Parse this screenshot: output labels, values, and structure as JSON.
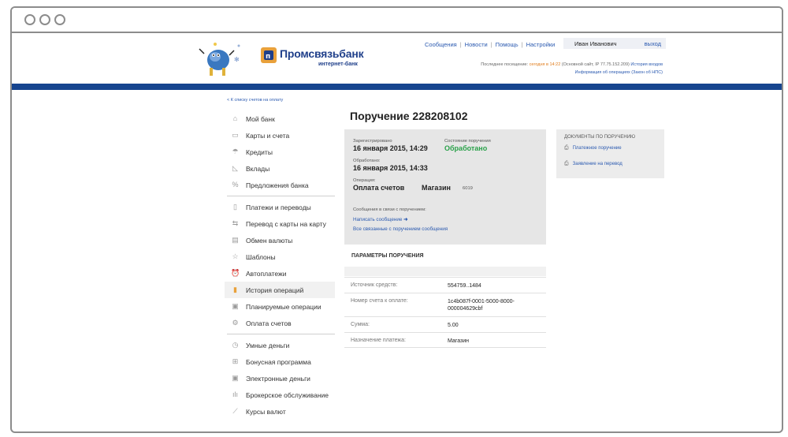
{
  "bank": {
    "name": "Промсвязьбанк",
    "subtitle": "интернет-банк",
    "brand_color": "#1f3f8a",
    "accent_color": "#e9a13b"
  },
  "topnav": {
    "items": [
      "Сообщения",
      "Новости",
      "Помощь",
      "Настройки"
    ],
    "user_name": "Иван Иванович",
    "logout": "выход",
    "last_visit_prefix": "Последнее посещение:",
    "last_visit_today": "сегодня в 14:22",
    "last_visit_site": "(Основной сайт, IP 77.75.152.209)",
    "login_history": "История входов",
    "op_info": "Информация об операциях (Закон об НПС)"
  },
  "back_link": "< К списку счетов на оплату",
  "sidebar": {
    "groups": [
      [
        {
          "label": "Мой банк",
          "icon": "home-icon"
        },
        {
          "label": "Карты и счета",
          "icon": "card-icon"
        },
        {
          "label": "Кредиты",
          "icon": "umbrella-icon"
        },
        {
          "label": "Вклады",
          "icon": "chart-icon"
        },
        {
          "label": "Предложения банка",
          "icon": "percent-icon"
        }
      ],
      [
        {
          "label": "Платежи и переводы",
          "icon": "document-icon"
        },
        {
          "label": "Перевод с карты на карту",
          "icon": "card-transfer-icon"
        },
        {
          "label": "Обмен валюты",
          "icon": "exchange-icon"
        },
        {
          "label": "Шаблоны",
          "icon": "star-icon"
        },
        {
          "label": "Автоплатежи",
          "icon": "alarm-icon"
        },
        {
          "label": "История операций",
          "icon": "history-icon",
          "active": true
        },
        {
          "label": "Планируемые операции",
          "icon": "calendar-icon"
        },
        {
          "label": "Оплата счетов",
          "icon": "bills-icon"
        }
      ],
      [
        {
          "label": "Умные деньги",
          "icon": "clock-icon"
        },
        {
          "label": "Бонусная программа",
          "icon": "gift-icon"
        },
        {
          "label": "Электронные деньги",
          "icon": "wallet-icon"
        },
        {
          "label": "Брокерское обслуживание",
          "icon": "bars-icon"
        },
        {
          "label": "Курсы валют",
          "icon": "trend-icon"
        }
      ]
    ]
  },
  "order": {
    "title": "Поручение 228208102",
    "registered_label": "Зарегистрировано",
    "registered_value": "16 января 2015, 14:29",
    "status_label": "Состояние поручения",
    "status_value": "Обработано",
    "status_color": "#2aa14a",
    "processed_label": "Обработано:",
    "processed_value": "16 января 2015, 14:33",
    "operation_label": "Операция:",
    "operation_value": "Оплата счетов",
    "merchant": "Магазин",
    "merchant_code": "6019",
    "messages_label": "Сообщения в связи с поручением:",
    "write_message": "Написать сообщение",
    "all_messages": "Все связанные с поручением сообщения"
  },
  "documents": {
    "title": "ДОКУМЕНТЫ ПО ПОРУЧЕНИЮ",
    "items": [
      "Платежное поручение",
      "Заявление на перевод"
    ]
  },
  "params": {
    "title": "ПАРАМЕТРЫ ПОРУЧЕНИЯ",
    "rows": [
      {
        "key": "Источник средств:",
        "value": "554759..1484"
      },
      {
        "key": "Номер счета к оплате:",
        "value": "1c4b087f-0001-5000-8000-000004629cbf"
      },
      {
        "key": "Сумма:",
        "value": "5.00"
      },
      {
        "key": "Назначение платежа:",
        "value": "Магазин"
      }
    ]
  }
}
